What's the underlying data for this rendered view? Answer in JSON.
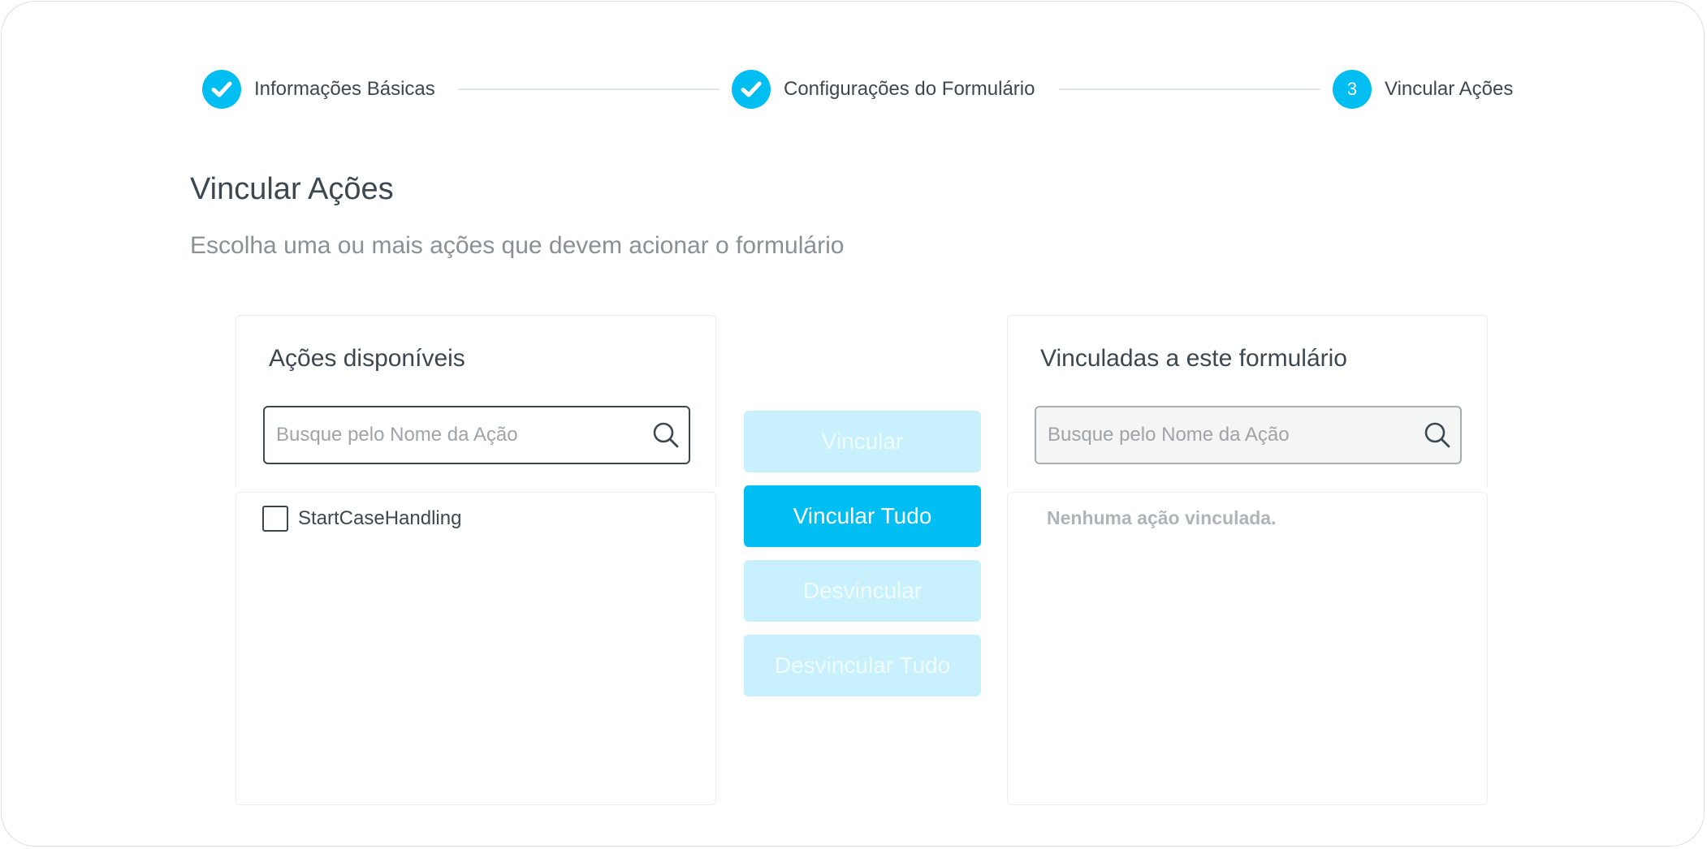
{
  "stepper": {
    "steps": [
      {
        "label": "Informações Básicas",
        "status": "completed",
        "icon": "check-icon"
      },
      {
        "label": "Configurações do Formulário",
        "status": "completed",
        "icon": "check-icon"
      },
      {
        "label": "Vincular Ações",
        "status": "current",
        "number": "3"
      }
    ]
  },
  "page": {
    "title": "Vincular Ações",
    "subtitle": "Escolha uma ou mais ações que devem acionar o formulário"
  },
  "available_panel": {
    "title": "Ações disponíveis",
    "search": {
      "placeholder": "Busque pelo Nome da Ação",
      "value": "",
      "icon": "search-icon"
    },
    "items": [
      {
        "label": "StartCaseHandling",
        "checked": false
      }
    ]
  },
  "linked_panel": {
    "title": "Vinculadas a este formulário",
    "search": {
      "placeholder": "Busque pelo Nome da Ação",
      "value": "",
      "icon": "search-icon"
    },
    "empty_text": "Nenhuma ação vinculada."
  },
  "actions": {
    "link": {
      "label": "Vincular",
      "enabled": false
    },
    "link_all": {
      "label": "Vincular Tudo",
      "enabled": true
    },
    "unlink": {
      "label": "Desvincular",
      "enabled": false
    },
    "unlink_all": {
      "label": "Desvincular Tudo",
      "enabled": false
    }
  },
  "colors": {
    "accent": "#00bdf2",
    "accent_disabled": "#c9f1fd",
    "text_primary": "#3c4750",
    "text_muted": "#8a9094",
    "border": "#eceef0"
  }
}
